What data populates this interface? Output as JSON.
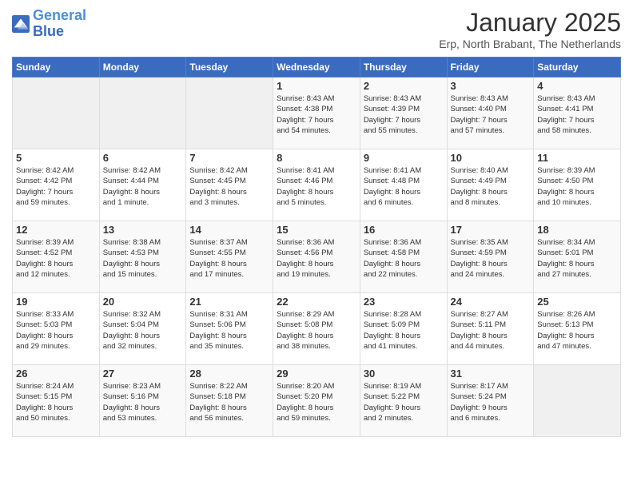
{
  "header": {
    "logo_line1": "General",
    "logo_line2": "Blue",
    "title": "January 2025",
    "subtitle": "Erp, North Brabant, The Netherlands"
  },
  "days_of_week": [
    "Sunday",
    "Monday",
    "Tuesday",
    "Wednesday",
    "Thursday",
    "Friday",
    "Saturday"
  ],
  "weeks": [
    [
      {
        "day": "",
        "info": ""
      },
      {
        "day": "",
        "info": ""
      },
      {
        "day": "",
        "info": ""
      },
      {
        "day": "1",
        "info": "Sunrise: 8:43 AM\nSunset: 4:38 PM\nDaylight: 7 hours\nand 54 minutes."
      },
      {
        "day": "2",
        "info": "Sunrise: 8:43 AM\nSunset: 4:39 PM\nDaylight: 7 hours\nand 55 minutes."
      },
      {
        "day": "3",
        "info": "Sunrise: 8:43 AM\nSunset: 4:40 PM\nDaylight: 7 hours\nand 57 minutes."
      },
      {
        "day": "4",
        "info": "Sunrise: 8:43 AM\nSunset: 4:41 PM\nDaylight: 7 hours\nand 58 minutes."
      }
    ],
    [
      {
        "day": "5",
        "info": "Sunrise: 8:42 AM\nSunset: 4:42 PM\nDaylight: 7 hours\nand 59 minutes."
      },
      {
        "day": "6",
        "info": "Sunrise: 8:42 AM\nSunset: 4:44 PM\nDaylight: 8 hours\nand 1 minute."
      },
      {
        "day": "7",
        "info": "Sunrise: 8:42 AM\nSunset: 4:45 PM\nDaylight: 8 hours\nand 3 minutes."
      },
      {
        "day": "8",
        "info": "Sunrise: 8:41 AM\nSunset: 4:46 PM\nDaylight: 8 hours\nand 5 minutes."
      },
      {
        "day": "9",
        "info": "Sunrise: 8:41 AM\nSunset: 4:48 PM\nDaylight: 8 hours\nand 6 minutes."
      },
      {
        "day": "10",
        "info": "Sunrise: 8:40 AM\nSunset: 4:49 PM\nDaylight: 8 hours\nand 8 minutes."
      },
      {
        "day": "11",
        "info": "Sunrise: 8:39 AM\nSunset: 4:50 PM\nDaylight: 8 hours\nand 10 minutes."
      }
    ],
    [
      {
        "day": "12",
        "info": "Sunrise: 8:39 AM\nSunset: 4:52 PM\nDaylight: 8 hours\nand 12 minutes."
      },
      {
        "day": "13",
        "info": "Sunrise: 8:38 AM\nSunset: 4:53 PM\nDaylight: 8 hours\nand 15 minutes."
      },
      {
        "day": "14",
        "info": "Sunrise: 8:37 AM\nSunset: 4:55 PM\nDaylight: 8 hours\nand 17 minutes."
      },
      {
        "day": "15",
        "info": "Sunrise: 8:36 AM\nSunset: 4:56 PM\nDaylight: 8 hours\nand 19 minutes."
      },
      {
        "day": "16",
        "info": "Sunrise: 8:36 AM\nSunset: 4:58 PM\nDaylight: 8 hours\nand 22 minutes."
      },
      {
        "day": "17",
        "info": "Sunrise: 8:35 AM\nSunset: 4:59 PM\nDaylight: 8 hours\nand 24 minutes."
      },
      {
        "day": "18",
        "info": "Sunrise: 8:34 AM\nSunset: 5:01 PM\nDaylight: 8 hours\nand 27 minutes."
      }
    ],
    [
      {
        "day": "19",
        "info": "Sunrise: 8:33 AM\nSunset: 5:03 PM\nDaylight: 8 hours\nand 29 minutes."
      },
      {
        "day": "20",
        "info": "Sunrise: 8:32 AM\nSunset: 5:04 PM\nDaylight: 8 hours\nand 32 minutes."
      },
      {
        "day": "21",
        "info": "Sunrise: 8:31 AM\nSunset: 5:06 PM\nDaylight: 8 hours\nand 35 minutes."
      },
      {
        "day": "22",
        "info": "Sunrise: 8:29 AM\nSunset: 5:08 PM\nDaylight: 8 hours\nand 38 minutes."
      },
      {
        "day": "23",
        "info": "Sunrise: 8:28 AM\nSunset: 5:09 PM\nDaylight: 8 hours\nand 41 minutes."
      },
      {
        "day": "24",
        "info": "Sunrise: 8:27 AM\nSunset: 5:11 PM\nDaylight: 8 hours\nand 44 minutes."
      },
      {
        "day": "25",
        "info": "Sunrise: 8:26 AM\nSunset: 5:13 PM\nDaylight: 8 hours\nand 47 minutes."
      }
    ],
    [
      {
        "day": "26",
        "info": "Sunrise: 8:24 AM\nSunset: 5:15 PM\nDaylight: 8 hours\nand 50 minutes."
      },
      {
        "day": "27",
        "info": "Sunrise: 8:23 AM\nSunset: 5:16 PM\nDaylight: 8 hours\nand 53 minutes."
      },
      {
        "day": "28",
        "info": "Sunrise: 8:22 AM\nSunset: 5:18 PM\nDaylight: 8 hours\nand 56 minutes."
      },
      {
        "day": "29",
        "info": "Sunrise: 8:20 AM\nSunset: 5:20 PM\nDaylight: 8 hours\nand 59 minutes."
      },
      {
        "day": "30",
        "info": "Sunrise: 8:19 AM\nSunset: 5:22 PM\nDaylight: 9 hours\nand 2 minutes."
      },
      {
        "day": "31",
        "info": "Sunrise: 8:17 AM\nSunset: 5:24 PM\nDaylight: 9 hours\nand 6 minutes."
      },
      {
        "day": "",
        "info": ""
      }
    ]
  ]
}
